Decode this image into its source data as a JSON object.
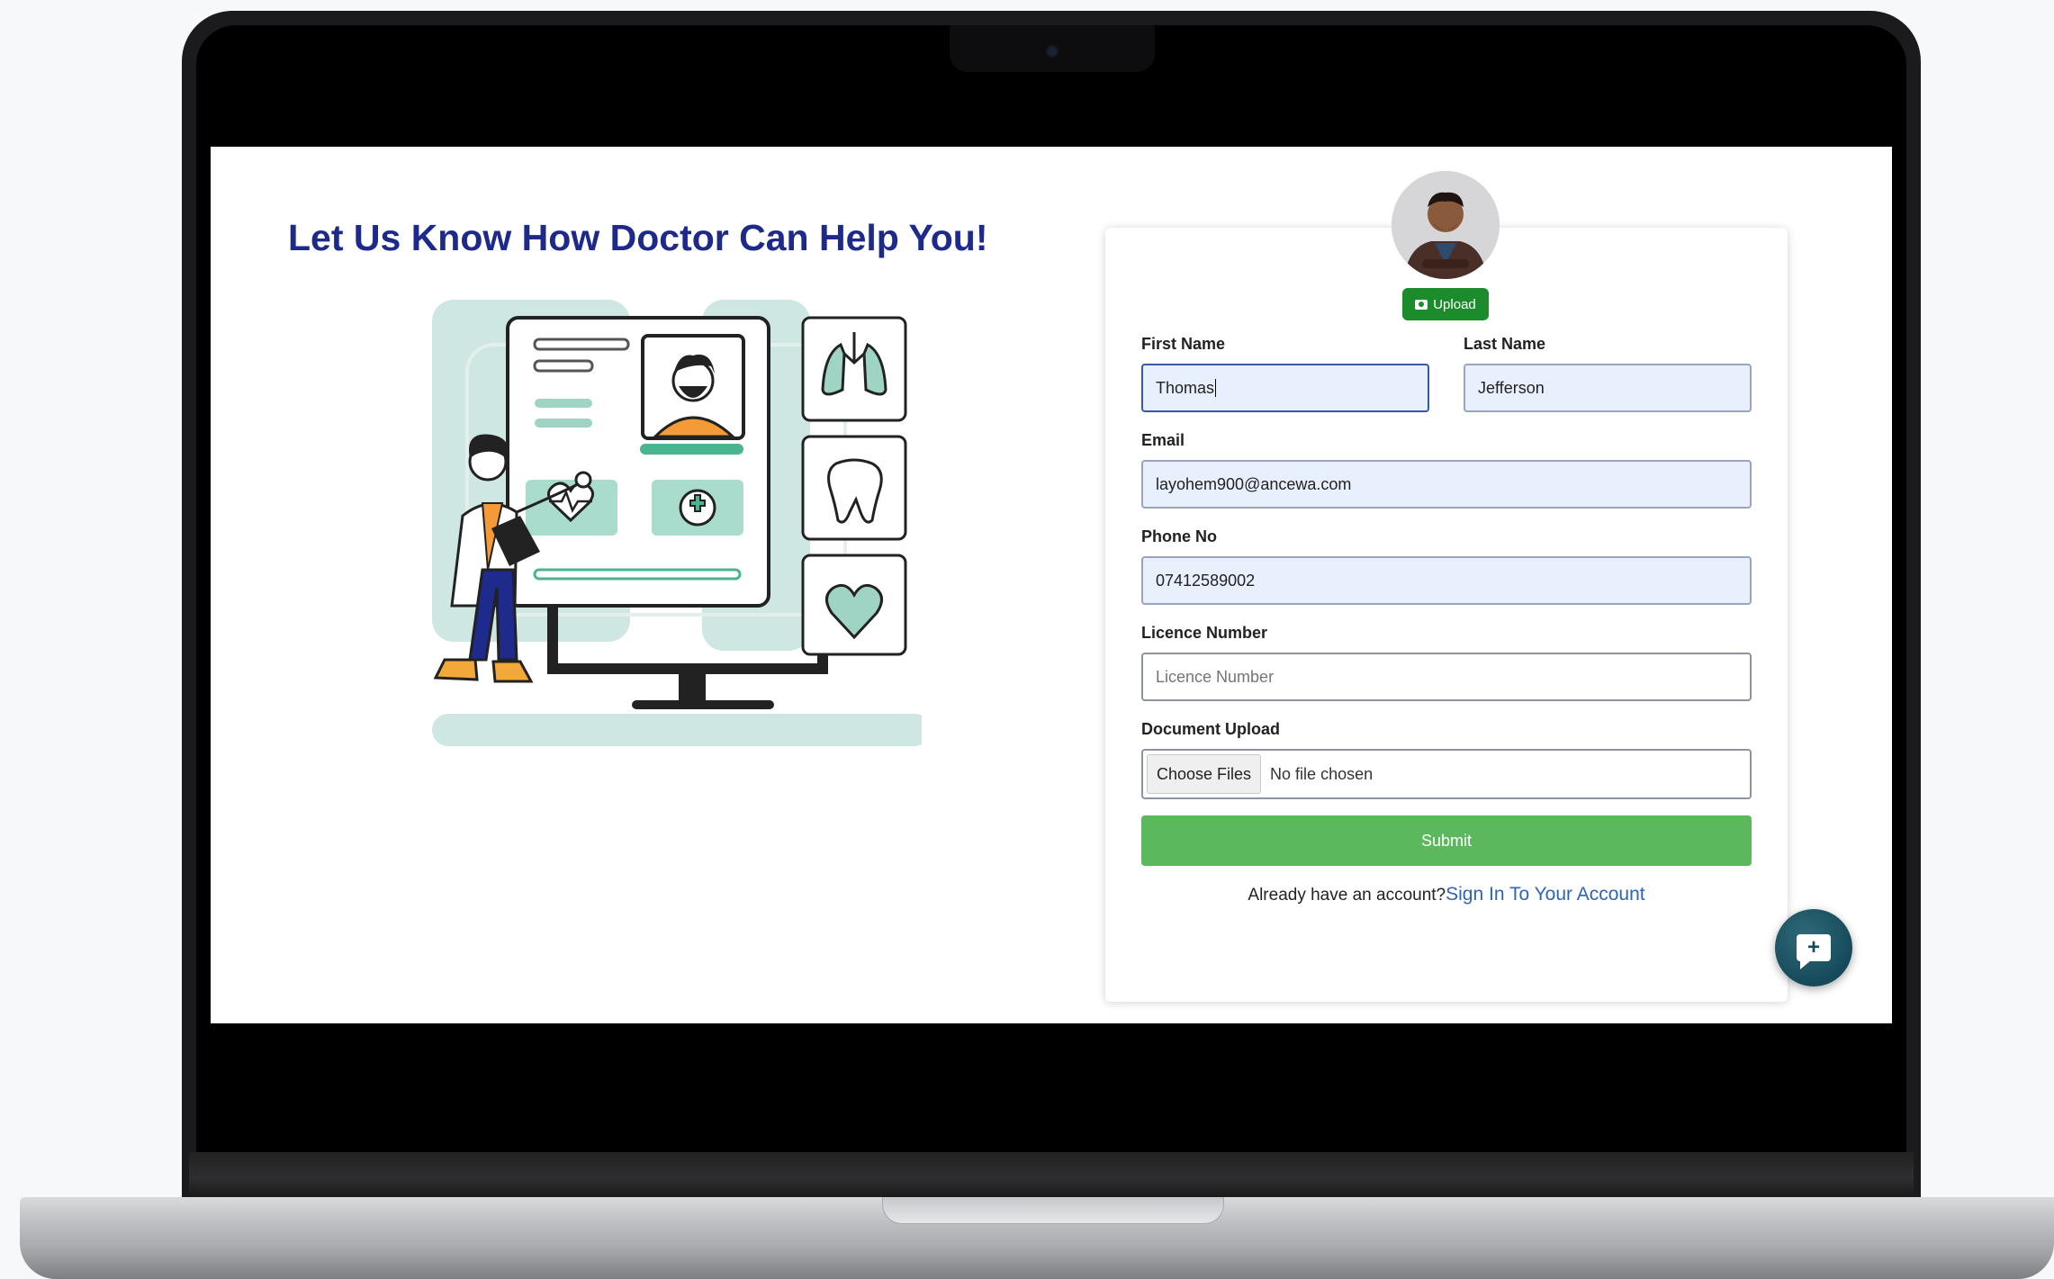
{
  "page": {
    "headline": "Let Us Know How Doctor Can Help You!"
  },
  "profile": {
    "upload_label": "Upload"
  },
  "form": {
    "first_name": {
      "label": "First Name",
      "value": "Thomas"
    },
    "last_name": {
      "label": "Last Name",
      "value": "Jefferson"
    },
    "email": {
      "label": "Email",
      "value": "layohem900@ancewa.com"
    },
    "phone": {
      "label": "Phone No",
      "value": "07412589002"
    },
    "licence": {
      "label": "Licence Number",
      "placeholder": "Licence Number",
      "value": ""
    },
    "document": {
      "label": "Document Upload",
      "button": "Choose Files",
      "status": "No file chosen"
    },
    "submit_label": "Submit"
  },
  "footer": {
    "prompt": "Already have an account?",
    "link": "Sign In To Your Account"
  },
  "icons": {
    "upload": "camera-icon",
    "chat": "chat-plus-icon",
    "illustration": [
      "lungs-icon",
      "tooth-icon",
      "heart-icon",
      "heartbeat-icon",
      "medical-plus-icon"
    ]
  },
  "colors": {
    "headline": "#1d2a8c",
    "upload_button": "#1c8b2b",
    "submit_button": "#5cb85c",
    "link": "#2e64b8",
    "filled_input": "#e8effd",
    "chat_fab": "#164a5a"
  }
}
